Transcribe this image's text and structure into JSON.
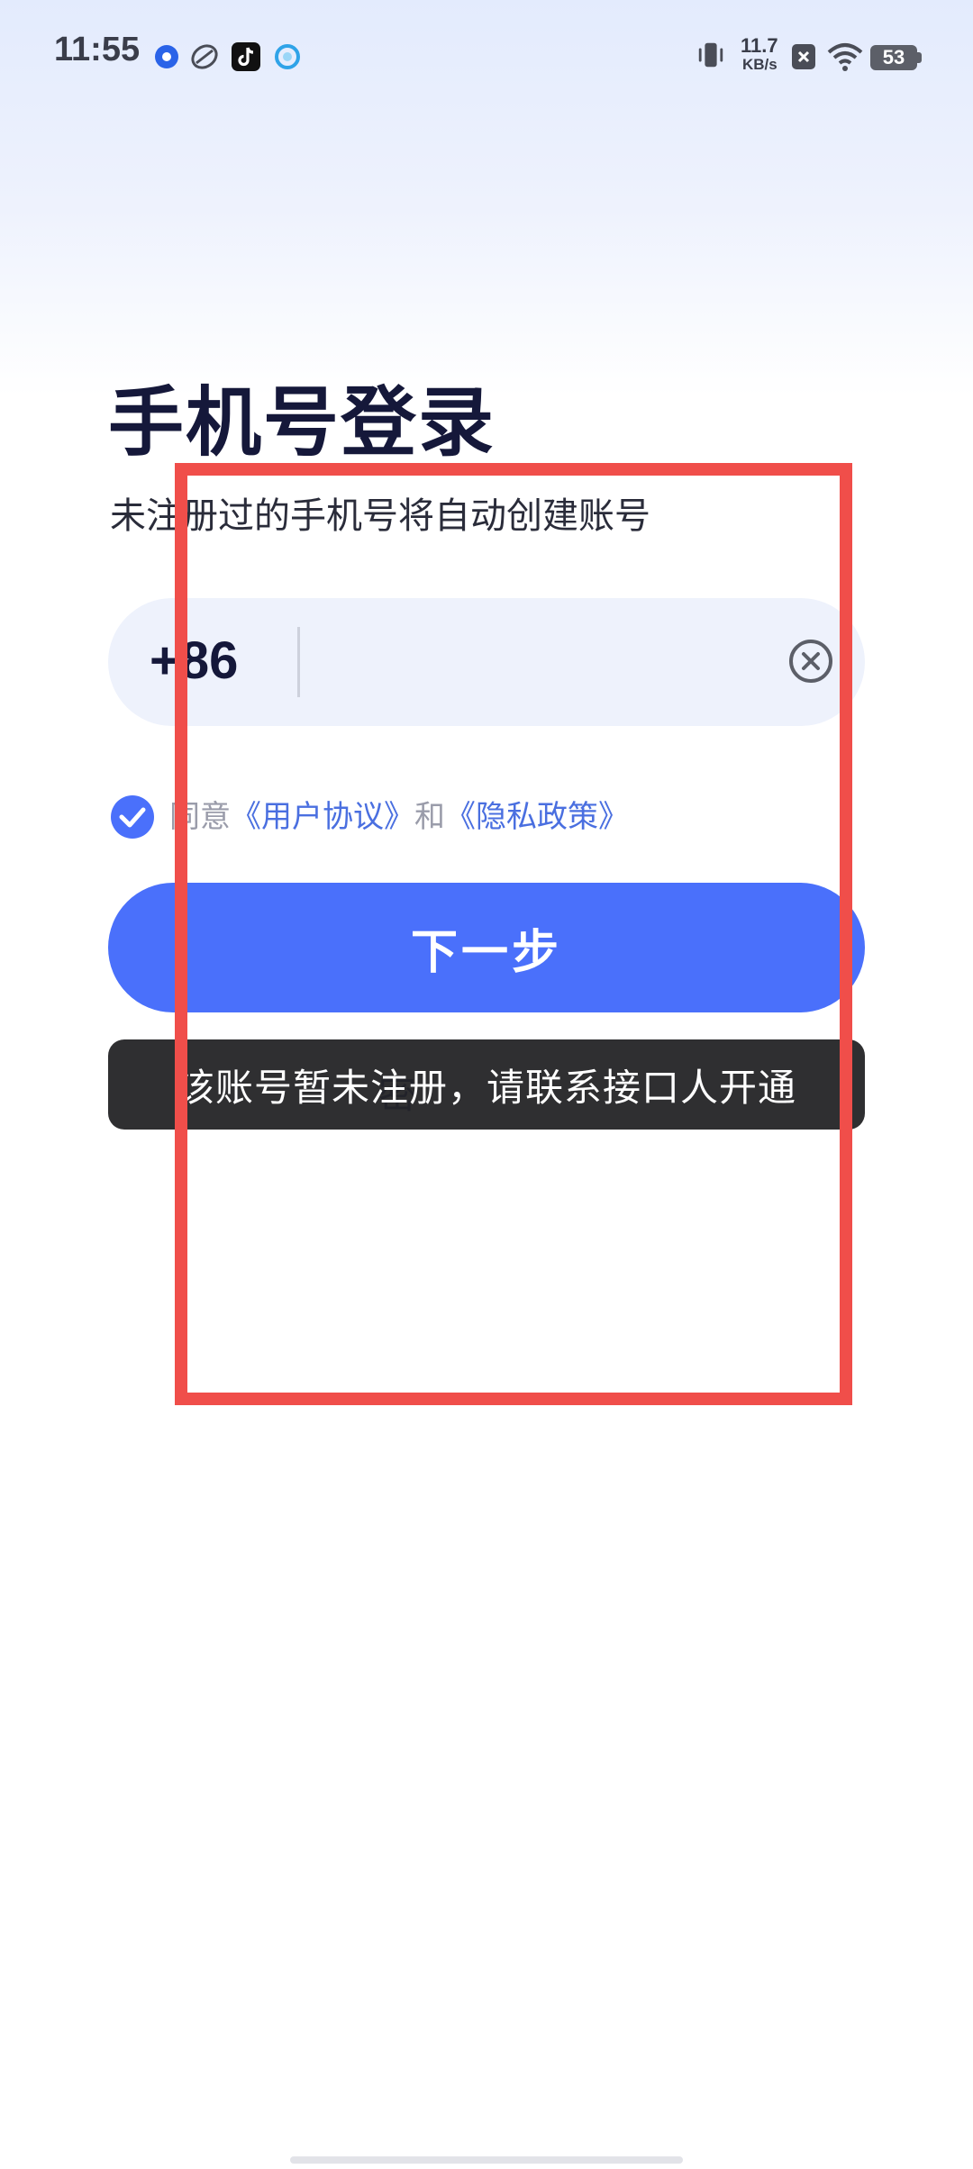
{
  "status_bar": {
    "time": "11:55",
    "net_speed_value": "11.7",
    "net_speed_unit": "KB/s",
    "battery": "53",
    "icons": [
      "app-notification-icon",
      "sports-ball-icon",
      "tiktok-icon",
      "browser-icon",
      "vibrate-icon",
      "no-sim-icon",
      "wifi-icon",
      "battery-icon"
    ]
  },
  "login": {
    "title": "手机号登录",
    "subtitle": "未注册过的手机号将自动创建账号",
    "country_code": "+86",
    "phone_value": "",
    "agreement": {
      "prefix": "同意",
      "user_agreement": "《用户协议》",
      "conjunction": "和",
      "privacy_policy": "《隐私政策》",
      "checked": true
    },
    "next_label": "下一步",
    "behind_text": "密"
  },
  "toast": {
    "message": "该账号暂未注册，请联系接口人开通"
  },
  "colors": {
    "accent": "#4a70fb",
    "title": "#15183a",
    "link": "#4a6fe0",
    "toast_bg": "#222224",
    "annotation": "#f04e4a"
  }
}
